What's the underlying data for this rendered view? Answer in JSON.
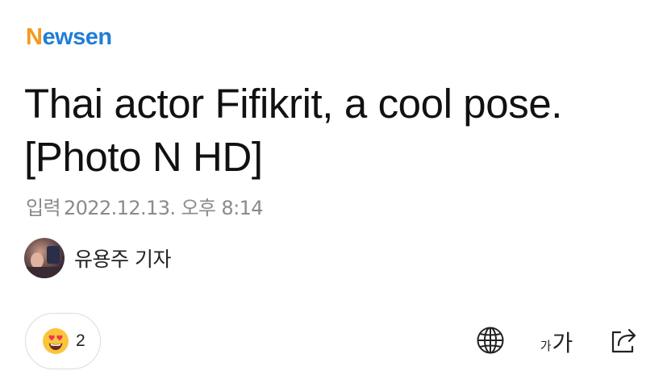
{
  "brand": {
    "logo_part1": "N",
    "logo_part2": "ewsen",
    "colors": {
      "orange": "#f39a1c",
      "blue": "#1f7ed8"
    }
  },
  "article": {
    "title": "Thai actor Fifikrit, a cool pose. [Photo N HD]",
    "date_label": "입력",
    "date_value": "2022.12.13. 오후 8:14",
    "reporter": "유용주 기자"
  },
  "toolbar": {
    "reaction_icon": "heart-eyes-emoji-icon",
    "reaction_count": "2",
    "translate_icon": "globe-icon",
    "font_small": "가",
    "font_big": "가",
    "share_icon": "share-icon"
  }
}
